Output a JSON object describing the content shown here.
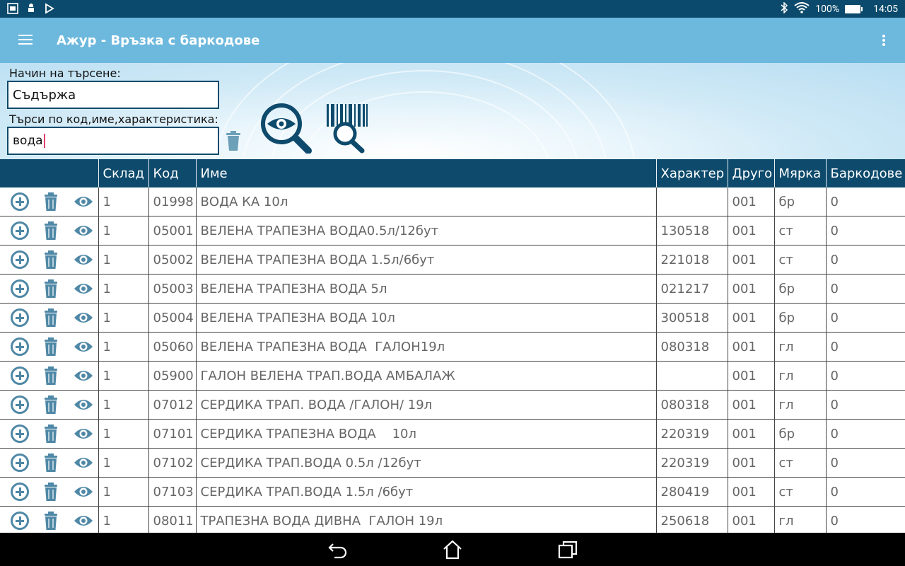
{
  "status_bar": {
    "battery": "100%",
    "time": "14:05"
  },
  "app_bar": {
    "title": "Ажур - Връзка с баркодове"
  },
  "search": {
    "mode_label": "Начин на търсене:",
    "mode_value": "Съдържа",
    "query_label": "Търси по код,име,характеристика:",
    "query_value": "вода"
  },
  "table": {
    "columns": [
      "Склад",
      "Код",
      "Име",
      "Характер",
      "Друго",
      "Мярка",
      "Баркодове"
    ],
    "rows": [
      [
        "1",
        "01998",
        "ВОДА КА 10л",
        "",
        "001",
        "бр",
        "0"
      ],
      [
        "1",
        "05001",
        "ВЕЛЕНА ТРАПЕЗНА ВОДА0.5л/12бут",
        "130518",
        "001",
        "ст",
        "0"
      ],
      [
        "1",
        "05002",
        "ВЕЛЕНА ТРАПЕЗНА ВОДА 1.5л/6бут",
        "221018",
        "001",
        "ст",
        "0"
      ],
      [
        "1",
        "05003",
        "ВЕЛЕНА ТРАПЕЗНА ВОДА 5л",
        "021217",
        "001",
        "бр",
        "0"
      ],
      [
        "1",
        "05004",
        "ВЕЛЕНА ТРАПЕЗНА ВОДА 10л",
        "300518",
        "001",
        "бр",
        "0"
      ],
      [
        "1",
        "05060",
        "ВЕЛЕНА ТРАПЕЗНА ВОДА  ГАЛОН19л",
        "080318",
        "001",
        "гл",
        "0"
      ],
      [
        "1",
        "05900",
        "ГАЛОН ВЕЛЕНА ТРАП.ВОДА АМБАЛАЖ",
        "",
        "001",
        "гл",
        "0"
      ],
      [
        "1",
        "07012",
        "СЕРДИКА ТРАП. ВОДА /ГАЛОН/ 19л",
        "080318",
        "001",
        "гл",
        "0"
      ],
      [
        "1",
        "07101",
        "СЕРДИКА ТРАПЕЗНА ВОДА    10л",
        "220319",
        "001",
        "бр",
        "0"
      ],
      [
        "1",
        "07102",
        "СЕРДИКА ТРАП.ВОДА 0.5л /12бут",
        "220319",
        "001",
        "ст",
        "0"
      ],
      [
        "1",
        "07103",
        "СЕРДИКА ТРАП.ВОДА 1.5л /6бут",
        "280419",
        "001",
        "ст",
        "0"
      ],
      [
        "1",
        "08011",
        "ТРАПЕЗНА ВОДА ДИВНА  ГАЛОН 19л",
        "250618",
        "001",
        "гл",
        "0"
      ],
      [
        "",
        "",
        "",
        "",
        "",
        "",
        ""
      ]
    ]
  },
  "colors": {
    "status_bar": "#0b4a6c",
    "app_bar": "#6db8dd",
    "table_header": "#0d4a6c",
    "icon": "#4f88a6"
  },
  "icons": {
    "status_left": [
      "screen-capture-icon",
      "android-debug-icon",
      "play-store-icon"
    ],
    "status_right": [
      "bluetooth-icon",
      "wifi-icon",
      "battery-icon"
    ],
    "nav": [
      "back-icon",
      "home-icon",
      "recents-icon"
    ]
  }
}
